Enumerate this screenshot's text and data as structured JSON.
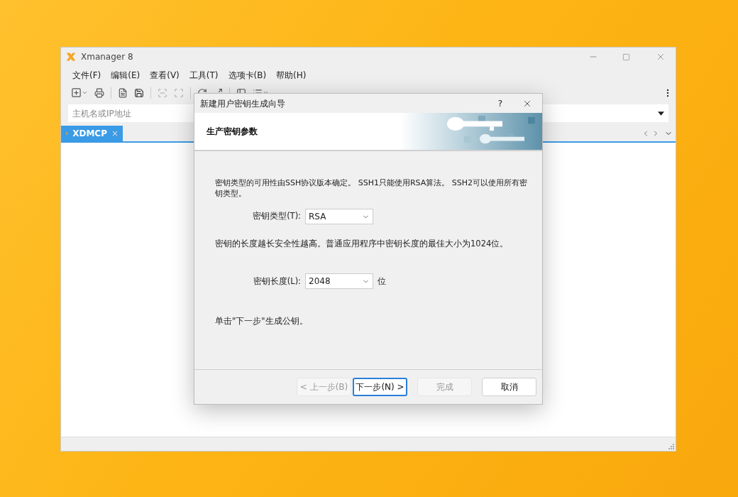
{
  "window": {
    "title": "Xmanager 8"
  },
  "menu": [
    "文件(F)",
    "编辑(E)",
    "查看(V)",
    "工具(T)",
    "选项卡(B)",
    "帮助(H)"
  ],
  "address_bar": {
    "placeholder": "主机名或IP地址"
  },
  "tabs": [
    {
      "label": "XDMCP",
      "selected": true,
      "close": "×"
    }
  ],
  "dialog": {
    "title": "新建用户密钥生成向导",
    "help": "?",
    "header": "生产密钥参数",
    "intro": "密钥类型的可用性由SSH协议版本确定。 SSH1只能使用RSA算法。 SSH2可以使用所有密钥类型。",
    "key_type": {
      "label": "密钥类型(T):",
      "value": "RSA"
    },
    "length_note": "密钥的长度越长安全性越高。普通应用程序中密钥长度的最佳大小为1024位。",
    "key_length": {
      "label": "密钥长度(L):",
      "value": "2048",
      "unit": "位"
    },
    "hint": "单击\"下一步\"生成公钥。",
    "buttons": [
      {
        "label": "< 上一步(B)",
        "disabled": true,
        "focused": false
      },
      {
        "label": "下一步(N) >",
        "disabled": false,
        "focused": true
      },
      {
        "label": "完成",
        "disabled": true,
        "focused": false
      },
      {
        "label": "取消",
        "disabled": false,
        "focused": false
      }
    ]
  }
}
